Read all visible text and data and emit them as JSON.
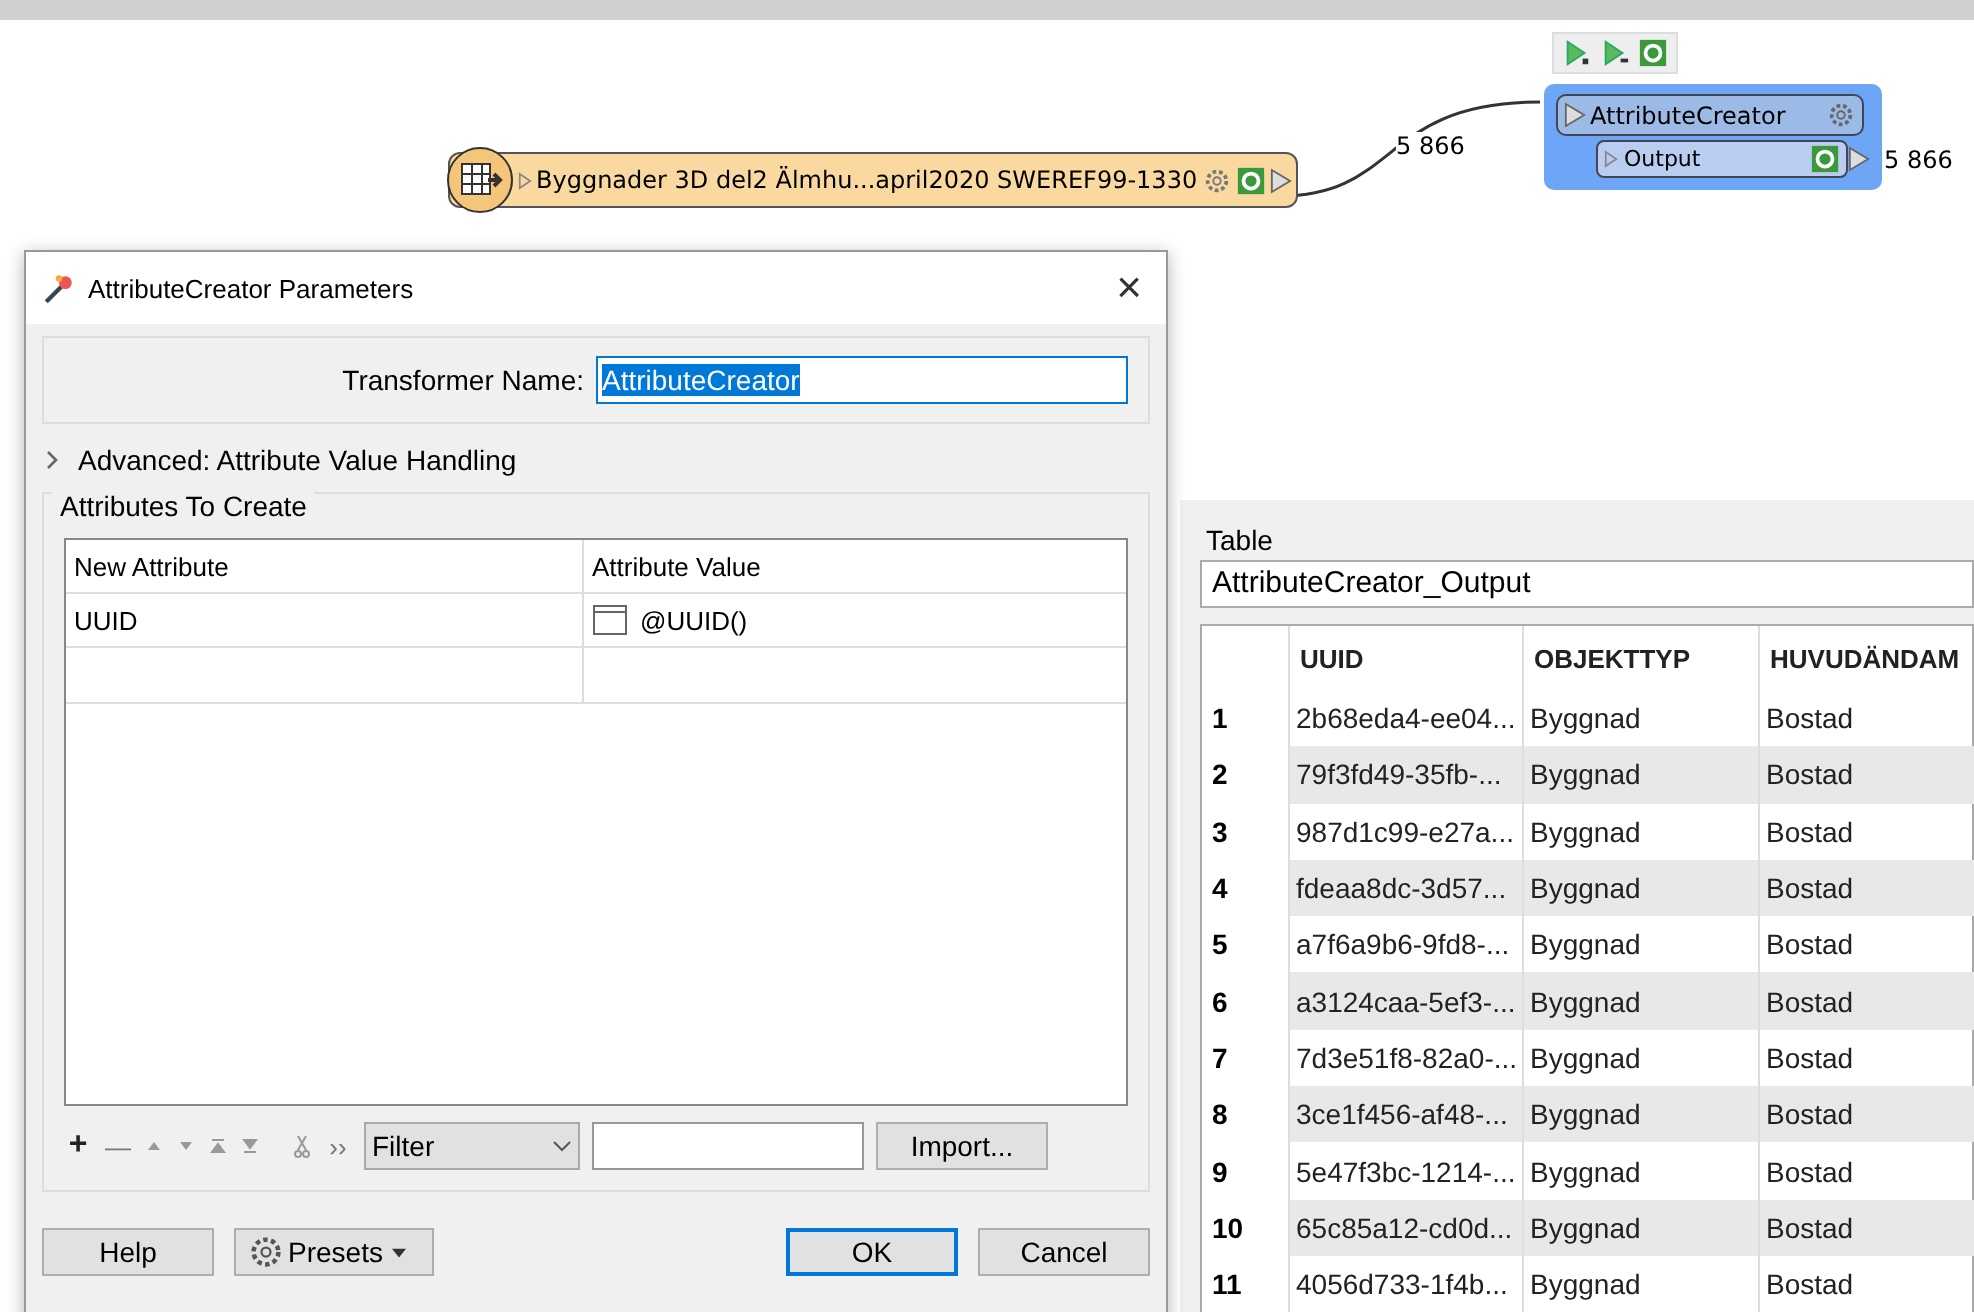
{
  "canvas": {
    "source_node": {
      "label": "Byggnader 3D del2 Älmhu...april2020 SWEREF99-1330"
    },
    "connection": {
      "count": "5 866"
    },
    "transformer": {
      "name": "AttributeCreator",
      "selected": true,
      "output_port": "Output",
      "output_count": "5 866"
    }
  },
  "dialog": {
    "title": "AttributeCreator Parameters",
    "close": "×",
    "transformer_name": {
      "label": "Transformer Name:",
      "value": "AttributeCreator"
    },
    "advanced": {
      "label": "Advanced: Attribute Value Handling",
      "expanded": false
    },
    "attributes": {
      "title": "Attributes To Create",
      "columns": [
        "New Attribute",
        "Attribute Value"
      ],
      "rows": [
        {
          "name": "UUID",
          "value": "@UUID()"
        }
      ]
    },
    "toolbar": {
      "add": "+",
      "remove": "—",
      "more": "››",
      "filter": "Filter",
      "import": "Import..."
    },
    "buttons": {
      "help": "Help",
      "presets": "Presets",
      "ok": "OK",
      "cancel": "Cancel"
    }
  },
  "table_panel": {
    "title": "Table",
    "table_name": "AttributeCreator_Output",
    "columns": [
      "UUID",
      "OBJEKTTYP",
      "HUVUDÄNDAM"
    ],
    "rows": [
      {
        "n": "1",
        "cells": [
          "2b68eda4-ee04...",
          "Byggnad",
          "Bostad"
        ]
      },
      {
        "n": "2",
        "cells": [
          "79f3fd49-35fb-...",
          "Byggnad",
          "Bostad"
        ]
      },
      {
        "n": "3",
        "cells": [
          "987d1c99-e27a...",
          "Byggnad",
          "Bostad"
        ]
      },
      {
        "n": "4",
        "cells": [
          "fdeaa8dc-3d57...",
          "Byggnad",
          "Bostad"
        ]
      },
      {
        "n": "5",
        "cells": [
          "a7f6a9b6-9fd8-...",
          "Byggnad",
          "Bostad"
        ]
      },
      {
        "n": "6",
        "cells": [
          "a3124caa-5ef3-...",
          "Byggnad",
          "Bostad"
        ]
      },
      {
        "n": "7",
        "cells": [
          "7d3e51f8-82a0-...",
          "Byggnad",
          "Bostad"
        ]
      },
      {
        "n": "8",
        "cells": [
          "3ce1f456-af48-...",
          "Byggnad",
          "Bostad"
        ]
      },
      {
        "n": "9",
        "cells": [
          "5e47f3bc-1214-...",
          "Byggnad",
          "Bostad"
        ]
      },
      {
        "n": "10",
        "cells": [
          "65c85a12-cd0d...",
          "Byggnad",
          "Bostad"
        ]
      },
      {
        "n": "11",
        "cells": [
          "4056d733-1f4b...",
          "Byggnad",
          "Bostad"
        ]
      }
    ]
  }
}
